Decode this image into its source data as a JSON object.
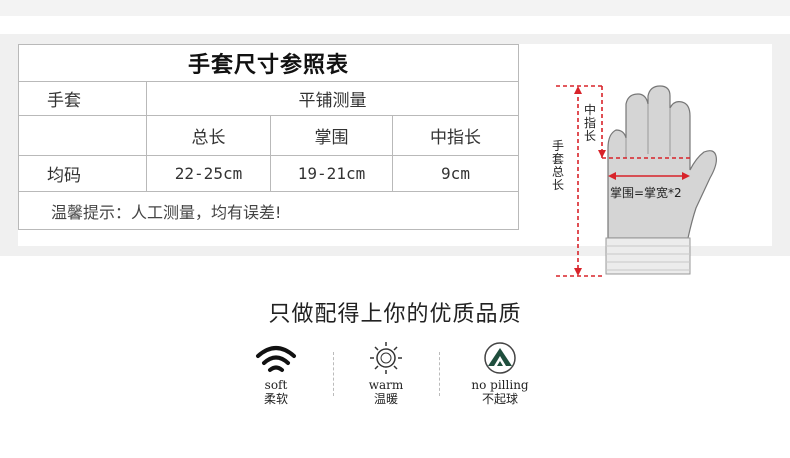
{
  "table": {
    "title": "手套尺寸参照表",
    "header_left": "手套",
    "header_right": "平铺测量",
    "col_total": "总长",
    "col_palm": "掌围",
    "col_middle": "中指长",
    "row_label": "均码",
    "val_total": "22-25cm",
    "val_palm": "19-21cm",
    "val_middle": "9cm",
    "note": "温馨提示：人工测量，均有误差!"
  },
  "diagram": {
    "length_label": "手套总长",
    "middle_label": "中指长",
    "palm_label": "掌围=掌宽*2"
  },
  "slogan": "只做配得上你的优质品质",
  "features": [
    {
      "en": "soft",
      "zh": "柔软",
      "icon": "wifi-icon"
    },
    {
      "en": "warm",
      "zh": "温暖",
      "icon": "sun-icon"
    },
    {
      "en": "no pilling",
      "zh": "不起球",
      "icon": "mountain-badge-icon"
    }
  ],
  "colors": {
    "accent_red": "#d8232a",
    "glove_gray": "#d5d5d5",
    "cuff": "#ececec"
  }
}
